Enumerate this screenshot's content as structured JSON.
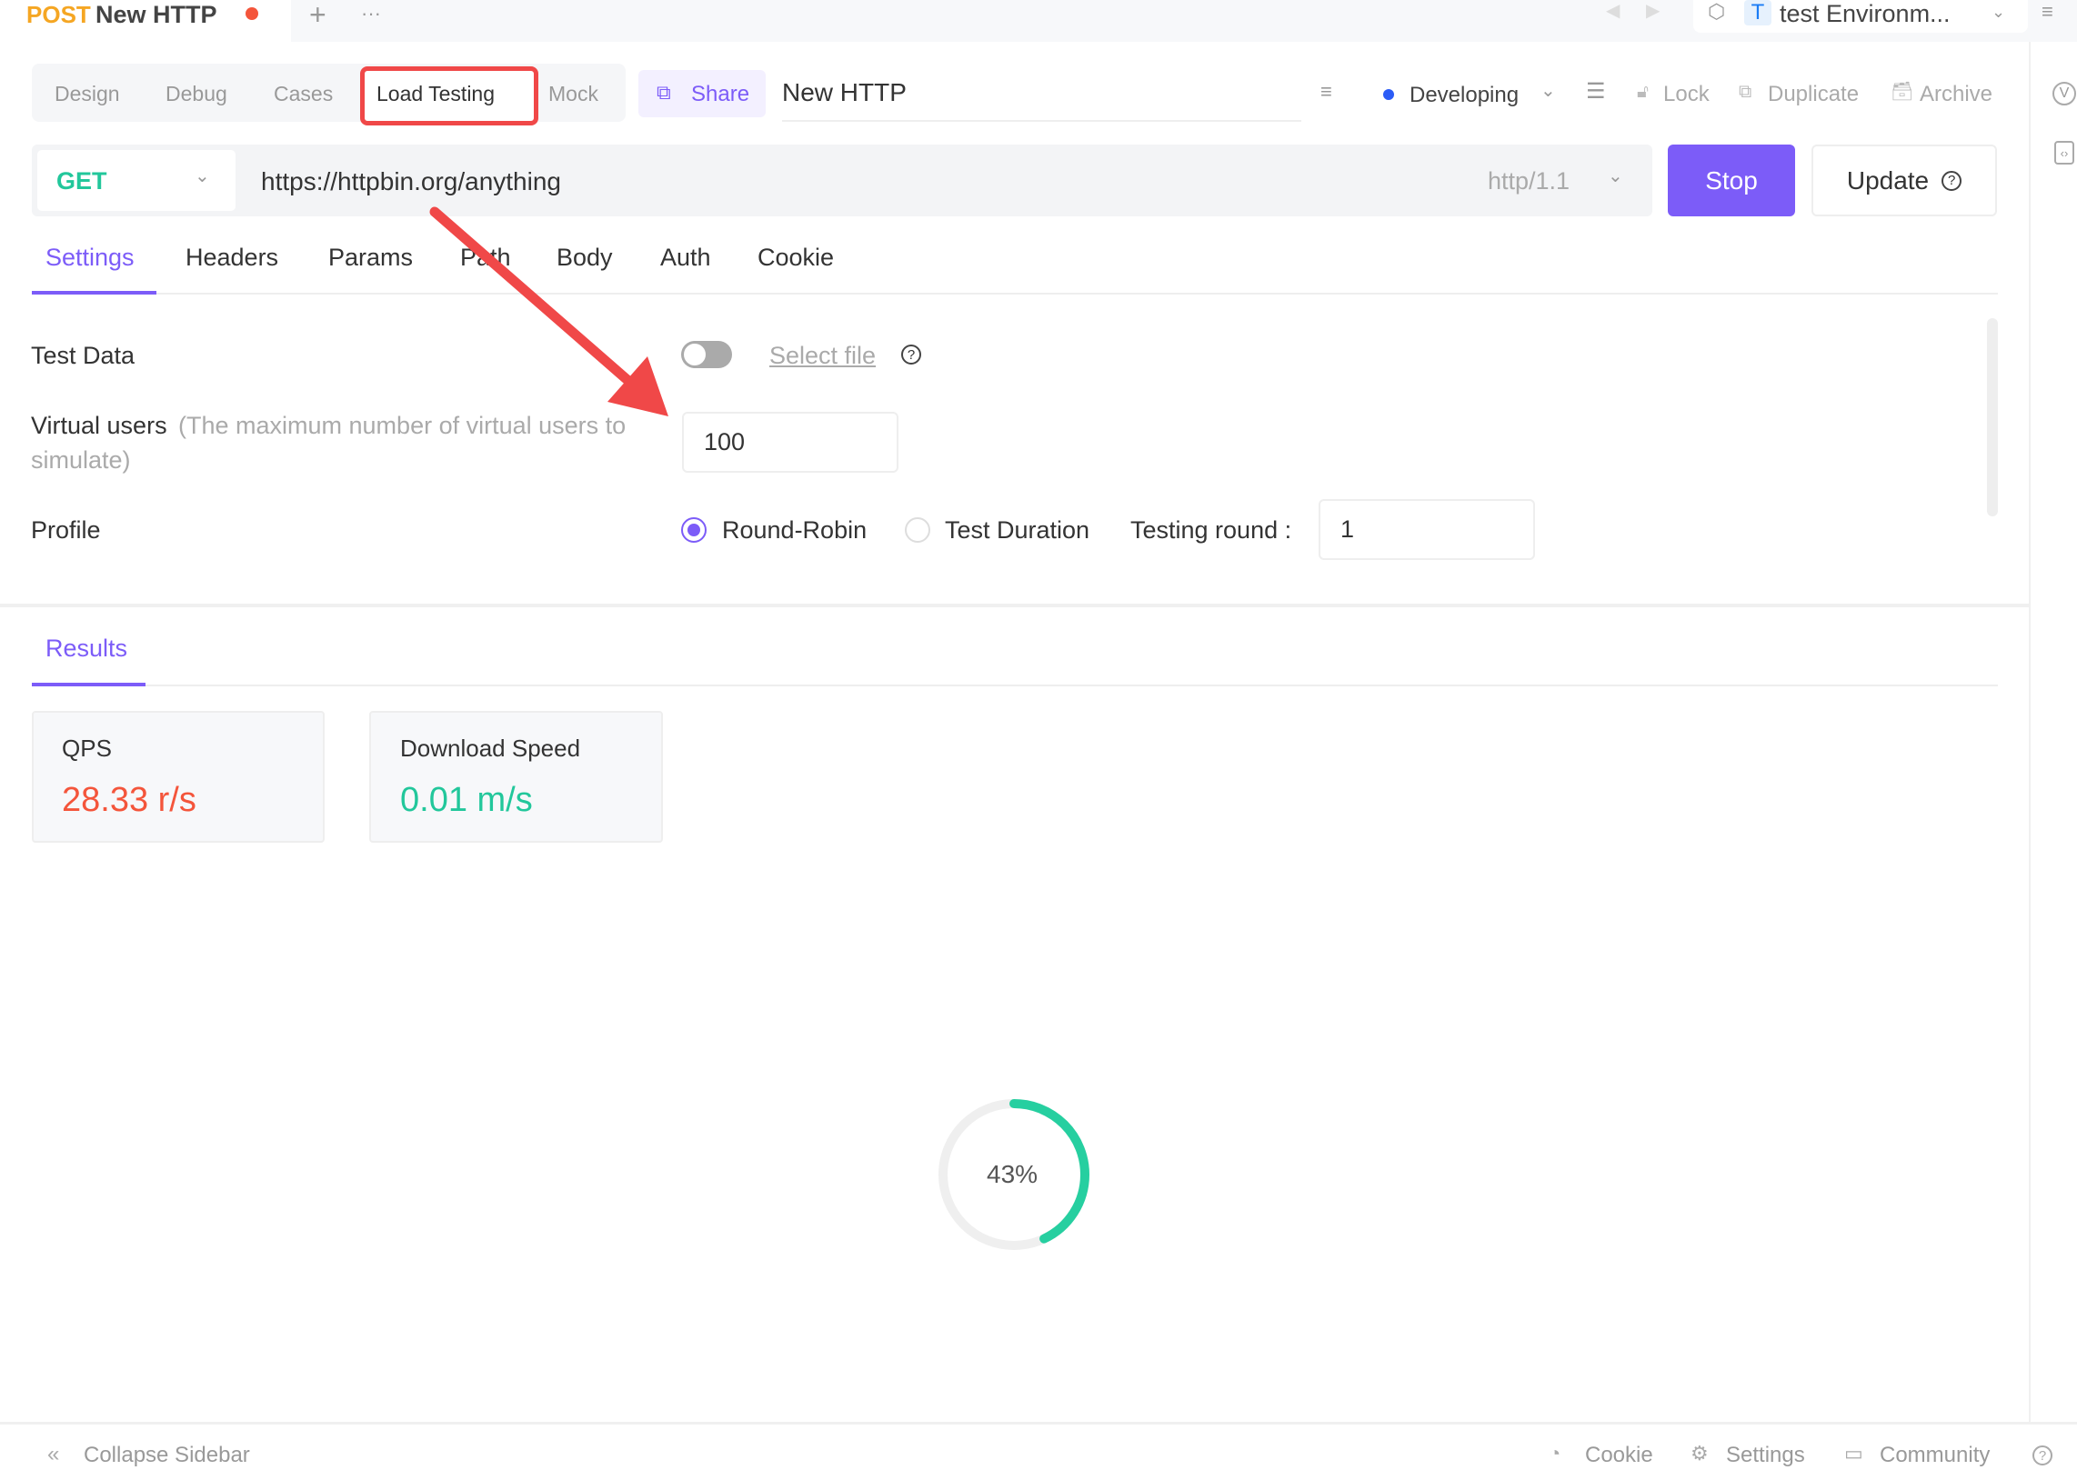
{
  "doc_tab": {
    "method": "POST",
    "title": "New HTTP",
    "unsaved_color": "#f4553b",
    "add": "+",
    "more": "···"
  },
  "env": {
    "badge": "T",
    "name": "test Environm..."
  },
  "mode_tabs": [
    {
      "label": "Design"
    },
    {
      "label": "Debug"
    },
    {
      "label": "Cases"
    },
    {
      "label": "Load Testing",
      "active": true
    },
    {
      "label": "Mock"
    }
  ],
  "share": "Share",
  "api_name": "New HTTP",
  "status": {
    "label": "Developing",
    "color": "#2b5cf6"
  },
  "actions": {
    "lock": "Lock",
    "duplicate": "Duplicate",
    "archive": "Archive"
  },
  "request": {
    "method": "GET",
    "url": "https://httpbin.org/anything",
    "protocol": "http/1.1"
  },
  "buttons": {
    "stop": "Stop",
    "update": "Update"
  },
  "settings_tabs": [
    {
      "label": "Settings",
      "active": true
    },
    {
      "label": "Headers"
    },
    {
      "label": "Params"
    },
    {
      "label": "Path"
    },
    {
      "label": "Body"
    },
    {
      "label": "Auth"
    },
    {
      "label": "Cookie"
    }
  ],
  "form": {
    "test_data": {
      "label": "Test Data",
      "enabled": false,
      "select_file": "Select file"
    },
    "virtual_users": {
      "label": "Virtual users",
      "hint": "(The maximum number of virtual users to",
      "hint2": "simulate)",
      "value": "100"
    },
    "profile": {
      "label": "Profile",
      "options": [
        "Round-Robin",
        "Test Duration"
      ],
      "selected": "Round-Robin",
      "testing_round_label": "Testing round :",
      "testing_round": "1"
    }
  },
  "results": {
    "tab": "Results",
    "qps": {
      "label": "QPS",
      "value": "28.33 r/s",
      "color": "#f4553b"
    },
    "download": {
      "label": "Download Speed",
      "value": "0.01 m/s",
      "color": "#22c79b"
    },
    "progress": {
      "percent": 43,
      "label": "43%",
      "color": "#26cfa0"
    }
  },
  "footer": {
    "collapse": "Collapse Sidebar",
    "cookie": "Cookie",
    "settings": "Settings",
    "community": "Community"
  },
  "accent": "#7c5cf8"
}
